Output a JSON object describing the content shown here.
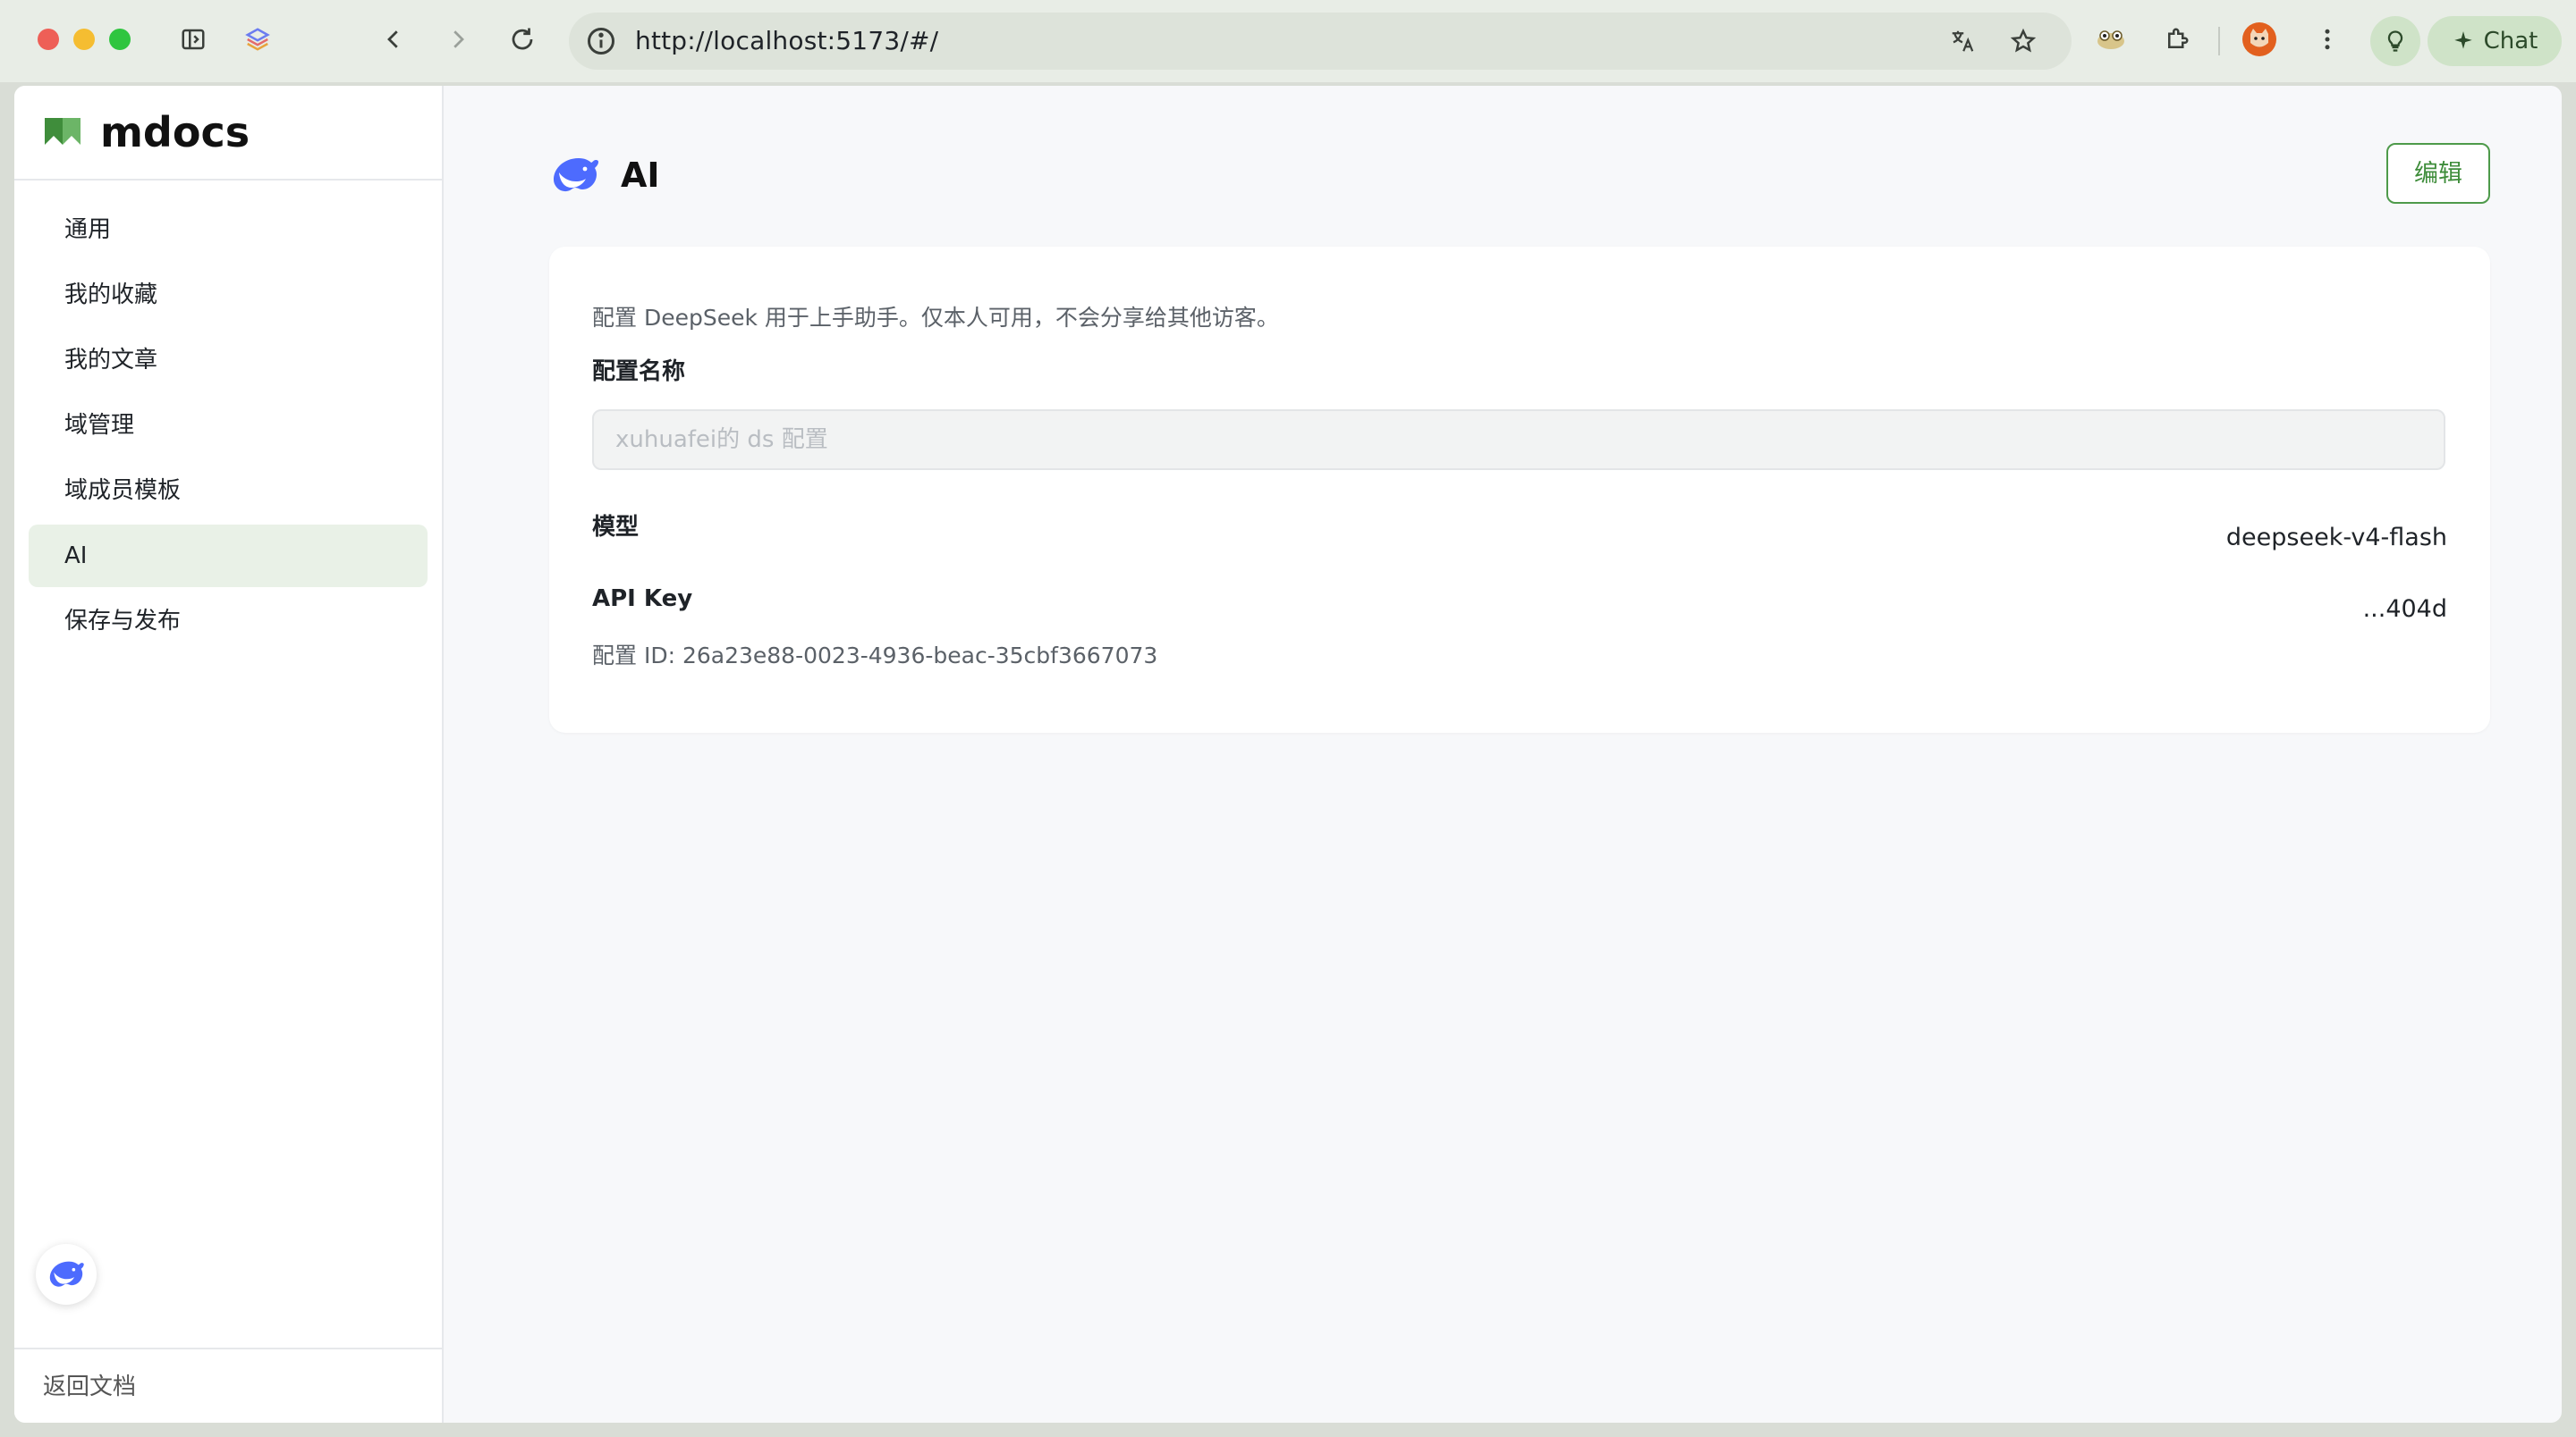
{
  "browser": {
    "url": "http://localhost:5173/#/",
    "chat_label": "Chat"
  },
  "brand": {
    "name": "mdocs",
    "accent": "#4e9a4a"
  },
  "sidebar": {
    "items": [
      {
        "label": "通用",
        "active": false
      },
      {
        "label": "我的收藏",
        "active": false
      },
      {
        "label": "我的文章",
        "active": false
      },
      {
        "label": "域管理",
        "active": false
      },
      {
        "label": "域成员模板",
        "active": false
      },
      {
        "label": "AI",
        "active": true
      },
      {
        "label": "保存与发布",
        "active": false
      }
    ],
    "footer_link": "返回文档"
  },
  "main": {
    "title": "AI",
    "edit_label": "编辑",
    "card": {
      "description": "配置 DeepSeek 用于上手助手。仅本人可用，不会分享给其他访客。",
      "name_label": "配置名称",
      "name_placeholder": "xuhuafei的 ds 配置",
      "model_label": "模型",
      "model_value": "deepseek-v4-flash",
      "apikey_label": "API Key",
      "apikey_value": "...404d",
      "config_id": "配置 ID: 26a23e88-0023-4936-beac-35cbf3667073"
    }
  },
  "icons": {
    "deepseek": "deepseek-whale-icon",
    "brand": "bookmark-flag-icon"
  },
  "colors": {
    "whale_blue": "#4d6bfe",
    "active_nav_bg": "#e9f1e7",
    "page_bg": "#f7f8fa"
  }
}
